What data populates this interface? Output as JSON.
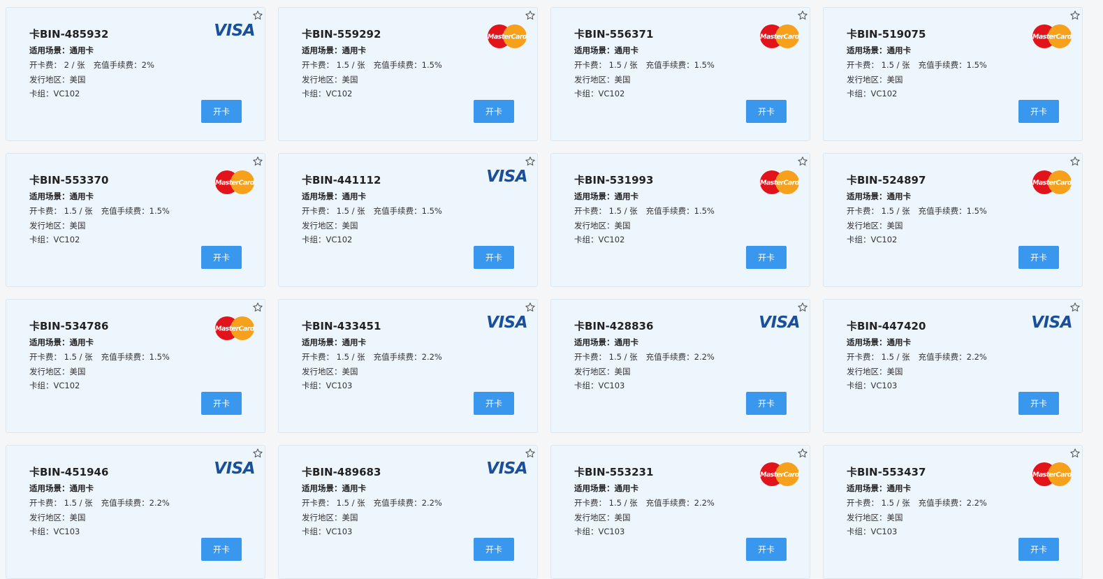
{
  "colors": {
    "card_bg": "#eef6fd",
    "button_bg": "#3a97ee",
    "visa_blue": "#1a4f9c",
    "mastercard_red": "#e2131b",
    "mastercard_orange": "#f7a01b"
  },
  "labels": {
    "scene_prefix": "适用场景：",
    "fee_prefix": "开卡费：",
    "recharge_prefix": "充值手续费：",
    "region_prefix": "发行地区：",
    "group_prefix": "卡组：",
    "button": "开卡",
    "star_icon": "star-outline-icon"
  },
  "cards": [
    {
      "title": "卡BIN-485932",
      "scene": "通用卡",
      "fee": "2 / 张",
      "recharge": "2%",
      "region": "美国",
      "group": "VC102",
      "brand": "visa"
    },
    {
      "title": "卡BIN-559292",
      "scene": "通用卡",
      "fee": "1.5 / 张",
      "recharge": "1.5%",
      "region": "美国",
      "group": "VC102",
      "brand": "mastercard"
    },
    {
      "title": "卡BIN-556371",
      "scene": "通用卡",
      "fee": "1.5 / 张",
      "recharge": "1.5%",
      "region": "美国",
      "group": "VC102",
      "brand": "mastercard"
    },
    {
      "title": "卡BIN-519075",
      "scene": "通用卡",
      "fee": "1.5 / 张",
      "recharge": "1.5%",
      "region": "美国",
      "group": "VC102",
      "brand": "mastercard"
    },
    {
      "title": "卡BIN-553370",
      "scene": "通用卡",
      "fee": "1.5 / 张",
      "recharge": "1.5%",
      "region": "美国",
      "group": "VC102",
      "brand": "mastercard"
    },
    {
      "title": "卡BIN-441112",
      "scene": "通用卡",
      "fee": "1.5 / 张",
      "recharge": "1.5%",
      "region": "美国",
      "group": "VC102",
      "brand": "visa"
    },
    {
      "title": "卡BIN-531993",
      "scene": "通用卡",
      "fee": "1.5 / 张",
      "recharge": "1.5%",
      "region": "美国",
      "group": "VC102",
      "brand": "mastercard"
    },
    {
      "title": "卡BIN-524897",
      "scene": "通用卡",
      "fee": "1.5 / 张",
      "recharge": "1.5%",
      "region": "美国",
      "group": "VC102",
      "brand": "mastercard"
    },
    {
      "title": "卡BIN-534786",
      "scene": "通用卡",
      "fee": "1.5 / 张",
      "recharge": "1.5%",
      "region": "美国",
      "group": "VC102",
      "brand": "mastercard"
    },
    {
      "title": "卡BIN-433451",
      "scene": "通用卡",
      "fee": "1.5 / 张",
      "recharge": "2.2%",
      "region": "美国",
      "group": "VC103",
      "brand": "visa"
    },
    {
      "title": "卡BIN-428836",
      "scene": "通用卡",
      "fee": "1.5 / 张",
      "recharge": "2.2%",
      "region": "美国",
      "group": "VC103",
      "brand": "visa"
    },
    {
      "title": "卡BIN-447420",
      "scene": "通用卡",
      "fee": "1.5 / 张",
      "recharge": "2.2%",
      "region": "美国",
      "group": "VC103",
      "brand": "visa"
    },
    {
      "title": "卡BIN-451946",
      "scene": "通用卡",
      "fee": "1.5 / 张",
      "recharge": "2.2%",
      "region": "美国",
      "group": "VC103",
      "brand": "visa"
    },
    {
      "title": "卡BIN-489683",
      "scene": "通用卡",
      "fee": "1.5 / 张",
      "recharge": "2.2%",
      "region": "美国",
      "group": "VC103",
      "brand": "visa"
    },
    {
      "title": "卡BIN-553231",
      "scene": "通用卡",
      "fee": "1.5 / 张",
      "recharge": "2.2%",
      "region": "美国",
      "group": "VC103",
      "brand": "mastercard"
    },
    {
      "title": "卡BIN-553437",
      "scene": "通用卡",
      "fee": "1.5 / 张",
      "recharge": "2.2%",
      "region": "美国",
      "group": "VC103",
      "brand": "mastercard"
    }
  ],
  "brand_text": {
    "visa": "VISA",
    "mastercard": "MasterCard"
  }
}
